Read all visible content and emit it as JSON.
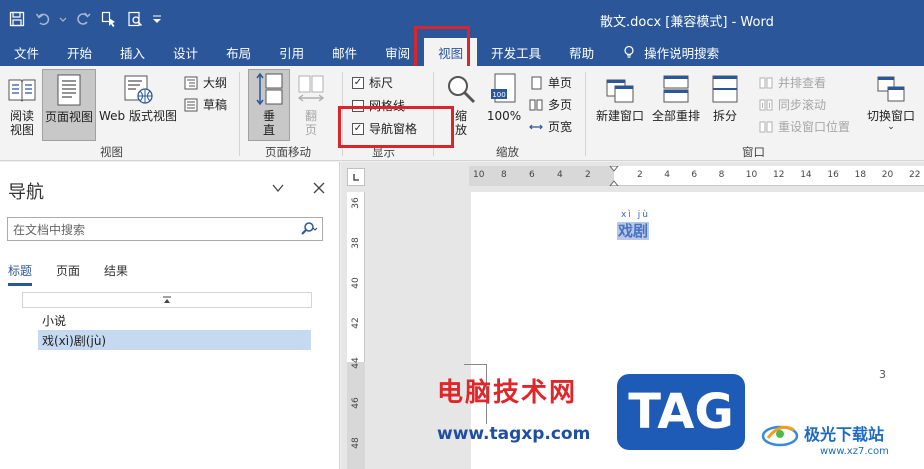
{
  "window": {
    "title": "散文.docx [兼容模式] - Word"
  },
  "tabs": [
    {
      "label": "文件"
    },
    {
      "label": "开始"
    },
    {
      "label": "插入"
    },
    {
      "label": "设计"
    },
    {
      "label": "布局"
    },
    {
      "label": "引用"
    },
    {
      "label": "邮件"
    },
    {
      "label": "审阅"
    },
    {
      "label": "视图",
      "active": true
    },
    {
      "label": "开发工具"
    },
    {
      "label": "帮助"
    },
    {
      "label": "操作说明搜索"
    }
  ],
  "ribbon": {
    "views": {
      "group_label": "视图",
      "read_mode": "阅读\n视图",
      "read_mode_l1": "阅读",
      "read_mode_l2": "视图",
      "print_layout": "页面视图",
      "web_layout": "Web 版式视图",
      "outline": "大纲",
      "draft": "草稿"
    },
    "page_movement": {
      "group_label": "页面移动",
      "vertical_l1": "垂",
      "vertical_l2": "直",
      "side_l1": "翻",
      "side_l2": "页"
    },
    "show": {
      "group_label": "显示",
      "ruler": "标尺",
      "ruler_checked": true,
      "gridlines": "网格线",
      "gridlines_checked": false,
      "nav_pane": "导航窗格",
      "nav_pane_checked": true
    },
    "zoom": {
      "group_label": "缩放",
      "zoom_l1": "缩",
      "zoom_l2": "放",
      "hundred": "100%",
      "one_page": "单页",
      "multi_page": "多页",
      "page_width": "页宽"
    },
    "window": {
      "group_label": "窗口",
      "new_window": "新建窗口",
      "arrange_all": "全部重排",
      "split": "拆分",
      "side_by_side": "并排查看",
      "sync_scroll": "同步滚动",
      "reset_position": "重设窗口位置",
      "switch_windows": "切换窗口"
    }
  },
  "nav_pane": {
    "title": "导航",
    "search_placeholder": "在文档中搜索",
    "tabs": [
      "标题",
      "页面",
      "结果"
    ],
    "headings": [
      {
        "text": "小说",
        "selected": false
      },
      {
        "text": "戏(xì)剧(jù)",
        "selected": true
      }
    ]
  },
  "document": {
    "ruby": "xì jù",
    "heading": "戏剧",
    "page_number": "3",
    "hruler_ticks": [
      "10",
      "8",
      "6",
      "4",
      "2",
      "2",
      "4",
      "6",
      "8",
      "10",
      "12",
      "14",
      "16",
      "18",
      "20",
      "22"
    ],
    "vruler_ticks": [
      "36",
      "38",
      "40",
      "42",
      "44",
      "46",
      "48"
    ]
  },
  "watermark": {
    "cn_text": "电脑技术网",
    "url": "www.tagxp.com",
    "tag": "TAG",
    "logo_text": "极光下载站",
    "logo_sub": "www.xz7.com"
  },
  "colors": {
    "brand": "#2b579a",
    "highlight": "#d9262c",
    "selected_item": "#c5d9f1"
  }
}
